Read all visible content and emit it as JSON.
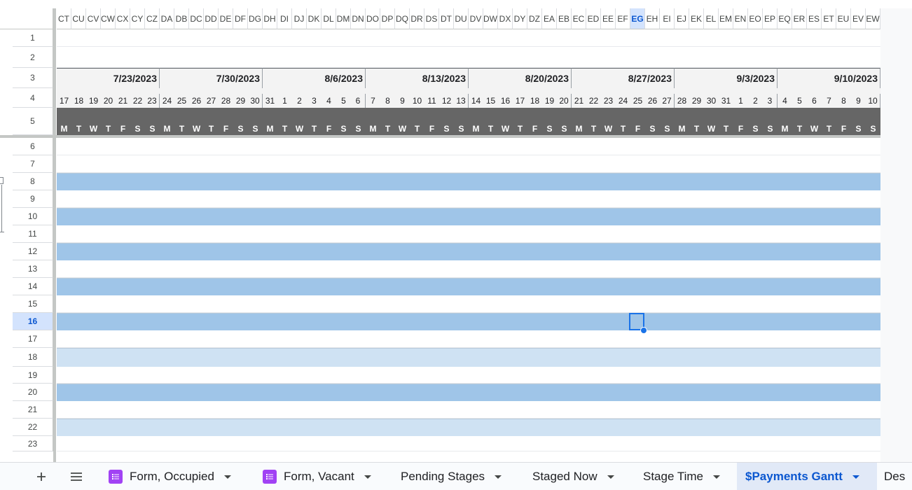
{
  "sheet": {
    "column_headers": [
      "CT",
      "CU",
      "CV",
      "CW",
      "CX",
      "CY",
      "CZ",
      "DA",
      "DB",
      "DC",
      "DD",
      "DE",
      "DF",
      "DG",
      "DH",
      "DI",
      "DJ",
      "DK",
      "DL",
      "DM",
      "DN",
      "DO",
      "DP",
      "DQ",
      "DR",
      "DS",
      "DT",
      "DU",
      "DV",
      "DW",
      "DX",
      "DY",
      "DZ",
      "EA",
      "EB",
      "EC",
      "ED",
      "EE",
      "EF",
      "EG",
      "EH",
      "EI",
      "EJ",
      "EK",
      "EL",
      "EM",
      "EN",
      "EO",
      "EP",
      "EQ",
      "ER",
      "ES",
      "ET",
      "EU",
      "EV",
      "EW"
    ],
    "selected_column": "EG",
    "row_numbers": [
      "1",
      "2",
      "3",
      "4",
      "5",
      "6",
      "7",
      "8",
      "9",
      "10",
      "11",
      "12",
      "13",
      "14",
      "15",
      "16",
      "17",
      "18",
      "19",
      "20",
      "21",
      "22",
      "23"
    ],
    "selected_row": "16",
    "weeks": [
      "7/23/2023",
      "7/30/2023",
      "8/6/2023",
      "8/13/2023",
      "8/20/2023",
      "8/27/2023",
      "9/3/2023",
      "9/10/2023"
    ],
    "day_numbers": [
      "17",
      "18",
      "19",
      "20",
      "21",
      "22",
      "23",
      "24",
      "25",
      "26",
      "27",
      "28",
      "29",
      "30",
      "31",
      "1",
      "2",
      "3",
      "4",
      "5",
      "6",
      "7",
      "8",
      "9",
      "10",
      "11",
      "12",
      "13",
      "14",
      "15",
      "16",
      "17",
      "18",
      "19",
      "20",
      "21",
      "22",
      "23",
      "24",
      "25",
      "26",
      "27",
      "28",
      "29",
      "30",
      "31",
      "1",
      "2",
      "3",
      "4",
      "5",
      "6",
      "7",
      "8",
      "9",
      "10"
    ],
    "day_letters": [
      "M",
      "T",
      "W",
      "T",
      "F",
      "S",
      "S"
    ],
    "band_rows": [
      {
        "row": "8",
        "shade": "dark"
      },
      {
        "row": "10",
        "shade": "dark"
      },
      {
        "row": "12",
        "shade": "dark"
      },
      {
        "row": "14",
        "shade": "dark"
      },
      {
        "row": "16",
        "shade": "dark"
      },
      {
        "row": "18",
        "shade": "light"
      },
      {
        "row": "20",
        "shade": "dark"
      },
      {
        "row": "22",
        "shade": "light"
      }
    ],
    "colors": {
      "band_dark": "#9fc5e8",
      "band_light": "#cfe2f3",
      "day_letter_bg": "#666666",
      "selection": "#1a73e8",
      "accent": "#0b57d0"
    }
  },
  "tabs": {
    "add_icon": "plus-icon",
    "menu_icon": "hamburger-icon",
    "items": [
      {
        "label": "Form, Occupied",
        "icon": "form-icon",
        "active": false
      },
      {
        "label": "Form, Vacant",
        "icon": "form-icon",
        "active": false
      },
      {
        "label": "Pending Stages",
        "icon": "",
        "active": false
      },
      {
        "label": "Staged Now",
        "icon": "",
        "active": false
      },
      {
        "label": "Stage Time",
        "icon": "",
        "active": false
      },
      {
        "label": "$Payments Gantt",
        "icon": "",
        "active": true
      },
      {
        "label": "Des",
        "icon": "",
        "active": false
      }
    ]
  }
}
